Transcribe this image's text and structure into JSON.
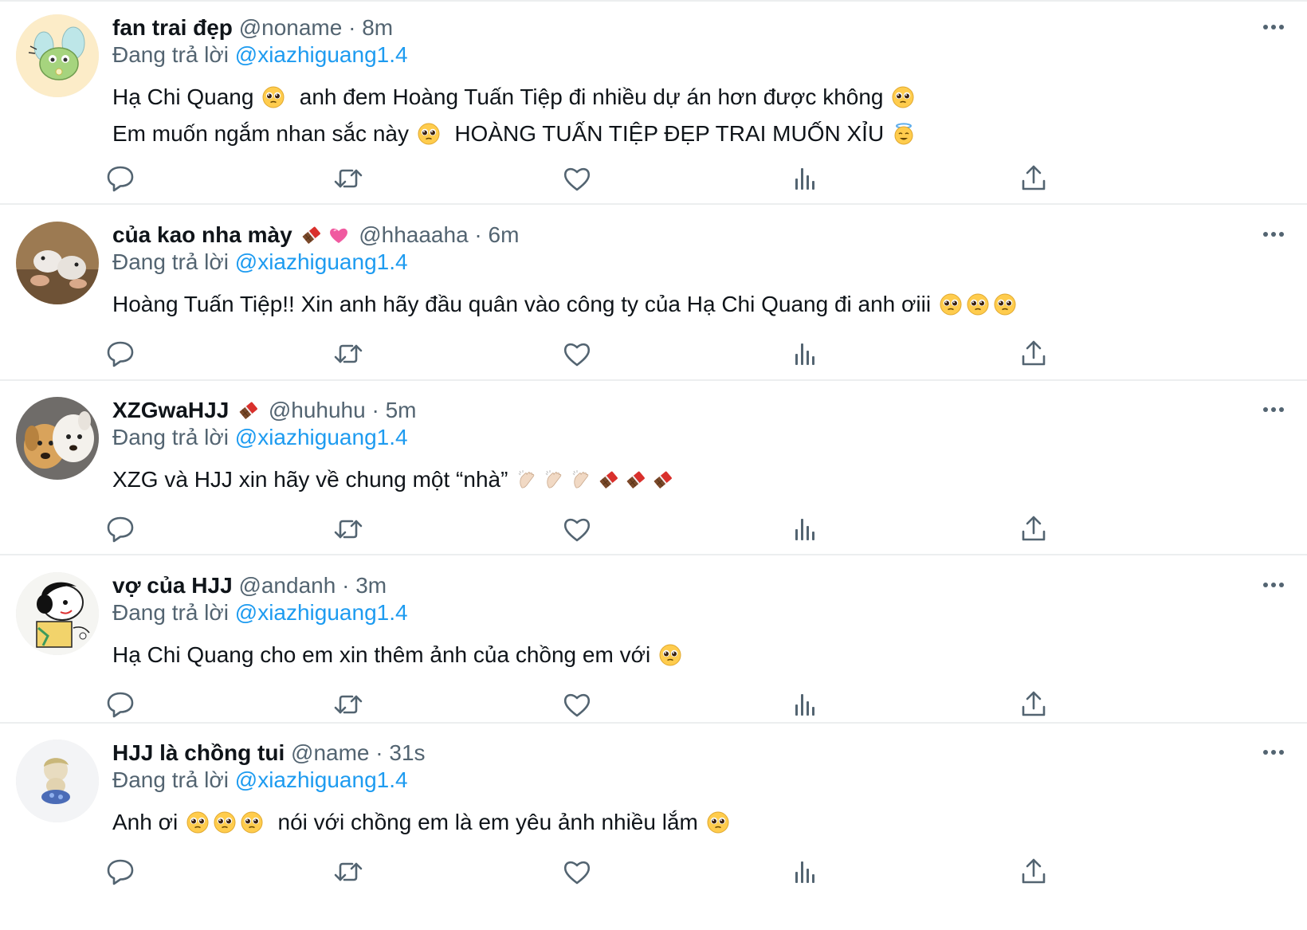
{
  "tweets": [
    {
      "name": "fan trai đẹp",
      "name_emojis": [],
      "handle": "@noname",
      "time": "8m",
      "reply_prefix": "Đang trả lời",
      "reply_to": "@xiazhiguang1.4",
      "avatar_icon": "frog-avatar-icon",
      "body_lines": [
        [
          {
            "t": "Hạ Chi Quang "
          },
          {
            "e": "pleading-face-icon"
          },
          {
            "t": "  anh đem Hoàng Tuấn Tiệp đi nhiều dự án hơn được không "
          },
          {
            "e": "pleading-face-icon"
          }
        ],
        [
          {
            "t": "Em muốn ngắm nhan sắc này "
          },
          {
            "e": "pleading-face-icon"
          },
          {
            "t": "  HOÀNG TUẤN TIỆP ĐẸP TRAI MUỐN XỈU "
          },
          {
            "e": "halo-face-icon"
          }
        ]
      ]
    },
    {
      "name": "của kao nha mày",
      "name_emojis": [
        "chocolate-icon",
        "heart-icon"
      ],
      "handle": "@hhaaaha",
      "time": "6m",
      "reply_prefix": "Đang trả lời",
      "reply_to": "@xiazhiguang1.4",
      "avatar_icon": "hamster-avatar-icon",
      "body_lines": [
        [
          {
            "t": "Hoàng Tuấn Tiệp!! Xin anh hãy đầu quân vào công ty của Hạ Chi Quang đi anh ơiii "
          },
          {
            "e": "pleading-face-icon"
          },
          {
            "e": "pleading-face-icon"
          },
          {
            "e": "pleading-face-icon"
          }
        ]
      ]
    },
    {
      "name": "XZGwaHJJ",
      "name_emojis": [
        "chocolate-icon"
      ],
      "handle": "@huhuhu",
      "time": "5m",
      "reply_prefix": "Đang trả lời",
      "reply_to": "@xiazhiguang1.4",
      "avatar_icon": "dogs-avatar-icon",
      "body_lines": [
        [
          {
            "t": "XZG và HJJ xin hãy về chung một “nhà” "
          },
          {
            "e": "clap-icon"
          },
          {
            "e": "clap-icon"
          },
          {
            "e": "clap-icon"
          },
          {
            "e": "chocolate-icon"
          },
          {
            "e": "chocolate-icon"
          },
          {
            "e": "chocolate-icon"
          }
        ]
      ]
    },
    {
      "name": "vợ của HJJ",
      "name_emojis": [],
      "handle": "@andanh",
      "time": "3m",
      "reply_prefix": "Đang trả lời",
      "reply_to": "@xiazhiguang1.4",
      "avatar_icon": "cartoon-avatar-icon",
      "body_lines": [
        [
          {
            "t": "Hạ Chi Quang cho em xin thêm ảnh của chồng em với "
          },
          {
            "e": "pleading-face-icon"
          }
        ]
      ]
    },
    {
      "name": "HJJ là chồng tui",
      "name_emojis": [],
      "handle": "@name",
      "time": "31s",
      "reply_prefix": "Đang trả lời",
      "reply_to": "@xiazhiguang1.4",
      "avatar_icon": "figure-avatar-icon",
      "body_lines": [
        [
          {
            "t": "Anh ơi "
          },
          {
            "e": "pleading-face-icon"
          },
          {
            "e": "pleading-face-icon"
          },
          {
            "e": "pleading-face-icon"
          },
          {
            "t": "  nói với chồng em là em yêu ảnh nhiều lắm "
          },
          {
            "e": "pleading-face-icon"
          }
        ]
      ]
    }
  ],
  "actions": [
    "reply-icon",
    "retweet-icon",
    "like-icon",
    "analytics-icon",
    "share-icon"
  ],
  "more_icon": "more-options-icon",
  "colors": {
    "name": "#0f1419",
    "secondary": "#536471",
    "link": "#1d9bf0",
    "divider": "#eceeef"
  }
}
